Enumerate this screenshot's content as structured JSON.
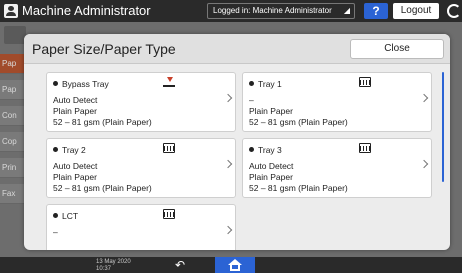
{
  "topbar": {
    "app_title": "Machine Administrator",
    "login_status": "Logged in: Machine Administrator",
    "help_label": "?",
    "logout_label": "Logout"
  },
  "background": {
    "sidebar_items": [
      "Pap",
      "Pap",
      "Con",
      "Cop",
      "Prin",
      "Fax"
    ]
  },
  "dialog": {
    "title": "Paper Size/Paper Type",
    "close_label": "Close",
    "trays": [
      {
        "name": "Bypass Tray",
        "icon": "bypass-tray-icon",
        "detect": "Auto Detect",
        "type": "Plain Paper",
        "weight": "52 – 81 gsm (Plain Paper)"
      },
      {
        "name": "Tray 1",
        "icon": "paper-tray-icon",
        "detect": "–",
        "type": "Plain Paper",
        "weight": "52 – 81 gsm (Plain Paper)"
      },
      {
        "name": "Tray 2",
        "icon": "paper-tray-icon",
        "detect": "Auto Detect",
        "type": "Plain Paper",
        "weight": "52 – 81 gsm (Plain Paper)"
      },
      {
        "name": "Tray 3",
        "icon": "paper-tray-icon",
        "detect": "Auto Detect",
        "type": "Plain Paper",
        "weight": "52 – 81 gsm (Plain Paper)"
      },
      {
        "name": "LCT",
        "icon": "paper-tray-icon",
        "detect": "–",
        "type": "",
        "weight": ""
      }
    ]
  },
  "bottombar": {
    "date_line1": "13 May 2020",
    "date_line2": "10:37"
  },
  "colors": {
    "accent": "#2b63d4",
    "active_side": "#a14b2b"
  }
}
